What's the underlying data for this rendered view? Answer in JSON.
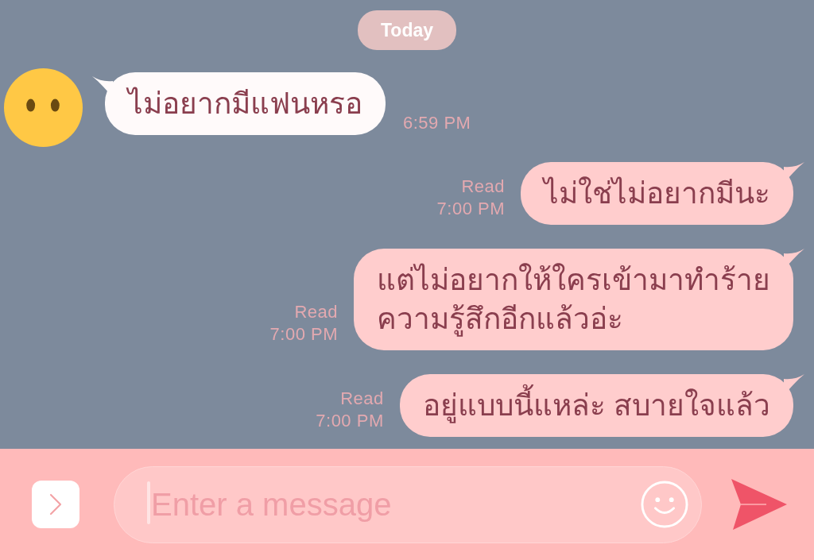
{
  "date_divider": {
    "label": "Today"
  },
  "messages": [
    {
      "kind": "incoming",
      "text": "ไม่อยากมีแฟนหรอ",
      "time": "6:59 PM"
    },
    {
      "kind": "outgoing",
      "status": "Read",
      "time": "7:00 PM",
      "text": "ไม่ใช่ไม่อยากมีนะ"
    },
    {
      "kind": "outgoing",
      "status": "Read",
      "time": "7:00 PM",
      "text": "แต่ไม่อยากให้ใครเข้ามาทำร้าย\nความรู้สึกอีกแล้วอ่ะ"
    },
    {
      "kind": "outgoing",
      "status": "Read",
      "time": "7:00 PM",
      "text": "อยู่แบบนี้แหล่ะ สบายใจแล้ว"
    }
  ],
  "composer": {
    "placeholder": "Enter a message"
  }
}
